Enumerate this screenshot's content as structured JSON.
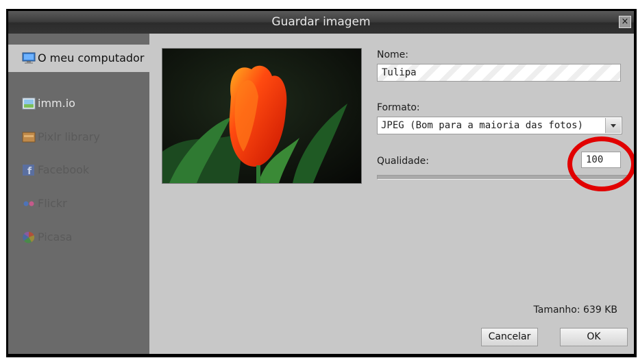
{
  "window": {
    "title": "Guardar imagem",
    "close_symbol": "×"
  },
  "sidebar": {
    "items": [
      {
        "label": "O meu computador",
        "icon": "computer-icon",
        "active": true
      },
      {
        "label": "imm.io",
        "icon": "image-icon"
      },
      {
        "label": "Pixlr library",
        "icon": "library-icon"
      },
      {
        "label": "Facebook",
        "icon": "facebook-icon"
      },
      {
        "label": "Flickr",
        "icon": "flickr-icon"
      },
      {
        "label": "Picasa",
        "icon": "picasa-icon"
      }
    ]
  },
  "form": {
    "name_label": "Nome:",
    "name_value": "Tulipa",
    "format_label": "Formato:",
    "format_value": "JPEG (Bom para a maioria das fotos)",
    "quality_label": "Qualidade:",
    "quality_value": "100",
    "quality_level": 1.0
  },
  "footer": {
    "size_text": "Tamanho: 639 KB",
    "cancel_label": "Cancelar",
    "ok_label": "OK"
  },
  "colors": {
    "highlight_ring": "#e10000",
    "titlebar": "#3a3a3a",
    "sidebar": "#6a6a6a",
    "panel": "#c8c8c8"
  }
}
